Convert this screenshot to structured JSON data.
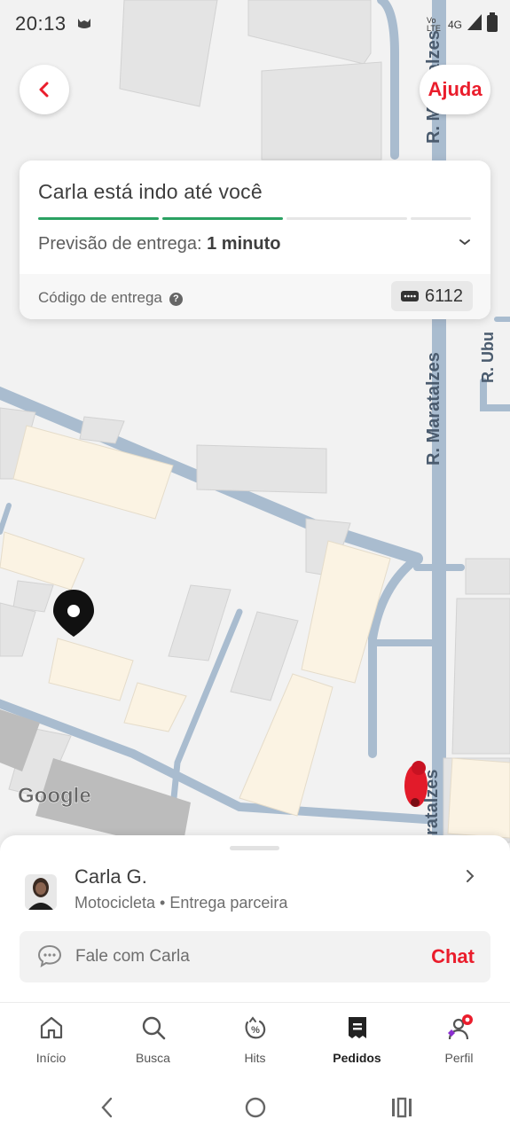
{
  "status_bar": {
    "time": "20:13",
    "network": "Vo LTE",
    "signal": "4G",
    "icons": [
      "cat-icon",
      "network-icon",
      "signal-icon",
      "battery-icon"
    ]
  },
  "top_bar": {
    "back_icon": "chevron-left-icon",
    "help_label": "Ajuda"
  },
  "map": {
    "street_labels": [
      "R. Maratalzes",
      "R. Maratalzes",
      "R. Ubu",
      "ratalzes"
    ],
    "google_label": "Google",
    "pin_icon": "location-pin-icon",
    "courier_icon": "motorcycle-courier-icon"
  },
  "status_card": {
    "title": "Carla está indo até você",
    "progress_steps": 4,
    "progress_completed": 2,
    "eta_label": "Previsão de entrega:",
    "eta_value": "1 minuto",
    "code_label": "Código de entrega",
    "code_value": "6112"
  },
  "driver": {
    "name": "Carla G.",
    "details": "Motocicleta • Entrega parceira",
    "chat_placeholder": "Fale com Carla",
    "chat_button": "Chat"
  },
  "bottom_nav": {
    "items": [
      {
        "label": "Início",
        "icon": "home-icon",
        "active": false
      },
      {
        "label": "Busca",
        "icon": "search-icon",
        "active": false
      },
      {
        "label": "Hits",
        "icon": "discount-icon",
        "active": false
      },
      {
        "label": "Pedidos",
        "icon": "receipt-icon",
        "active": true
      },
      {
        "label": "Perfil",
        "icon": "profile-icon",
        "active": false
      }
    ]
  },
  "colors": {
    "brand": "#ea1d2c",
    "progress": "#2aa162",
    "map_road": "#a9bccf",
    "map_building": "#fbf3e3"
  }
}
